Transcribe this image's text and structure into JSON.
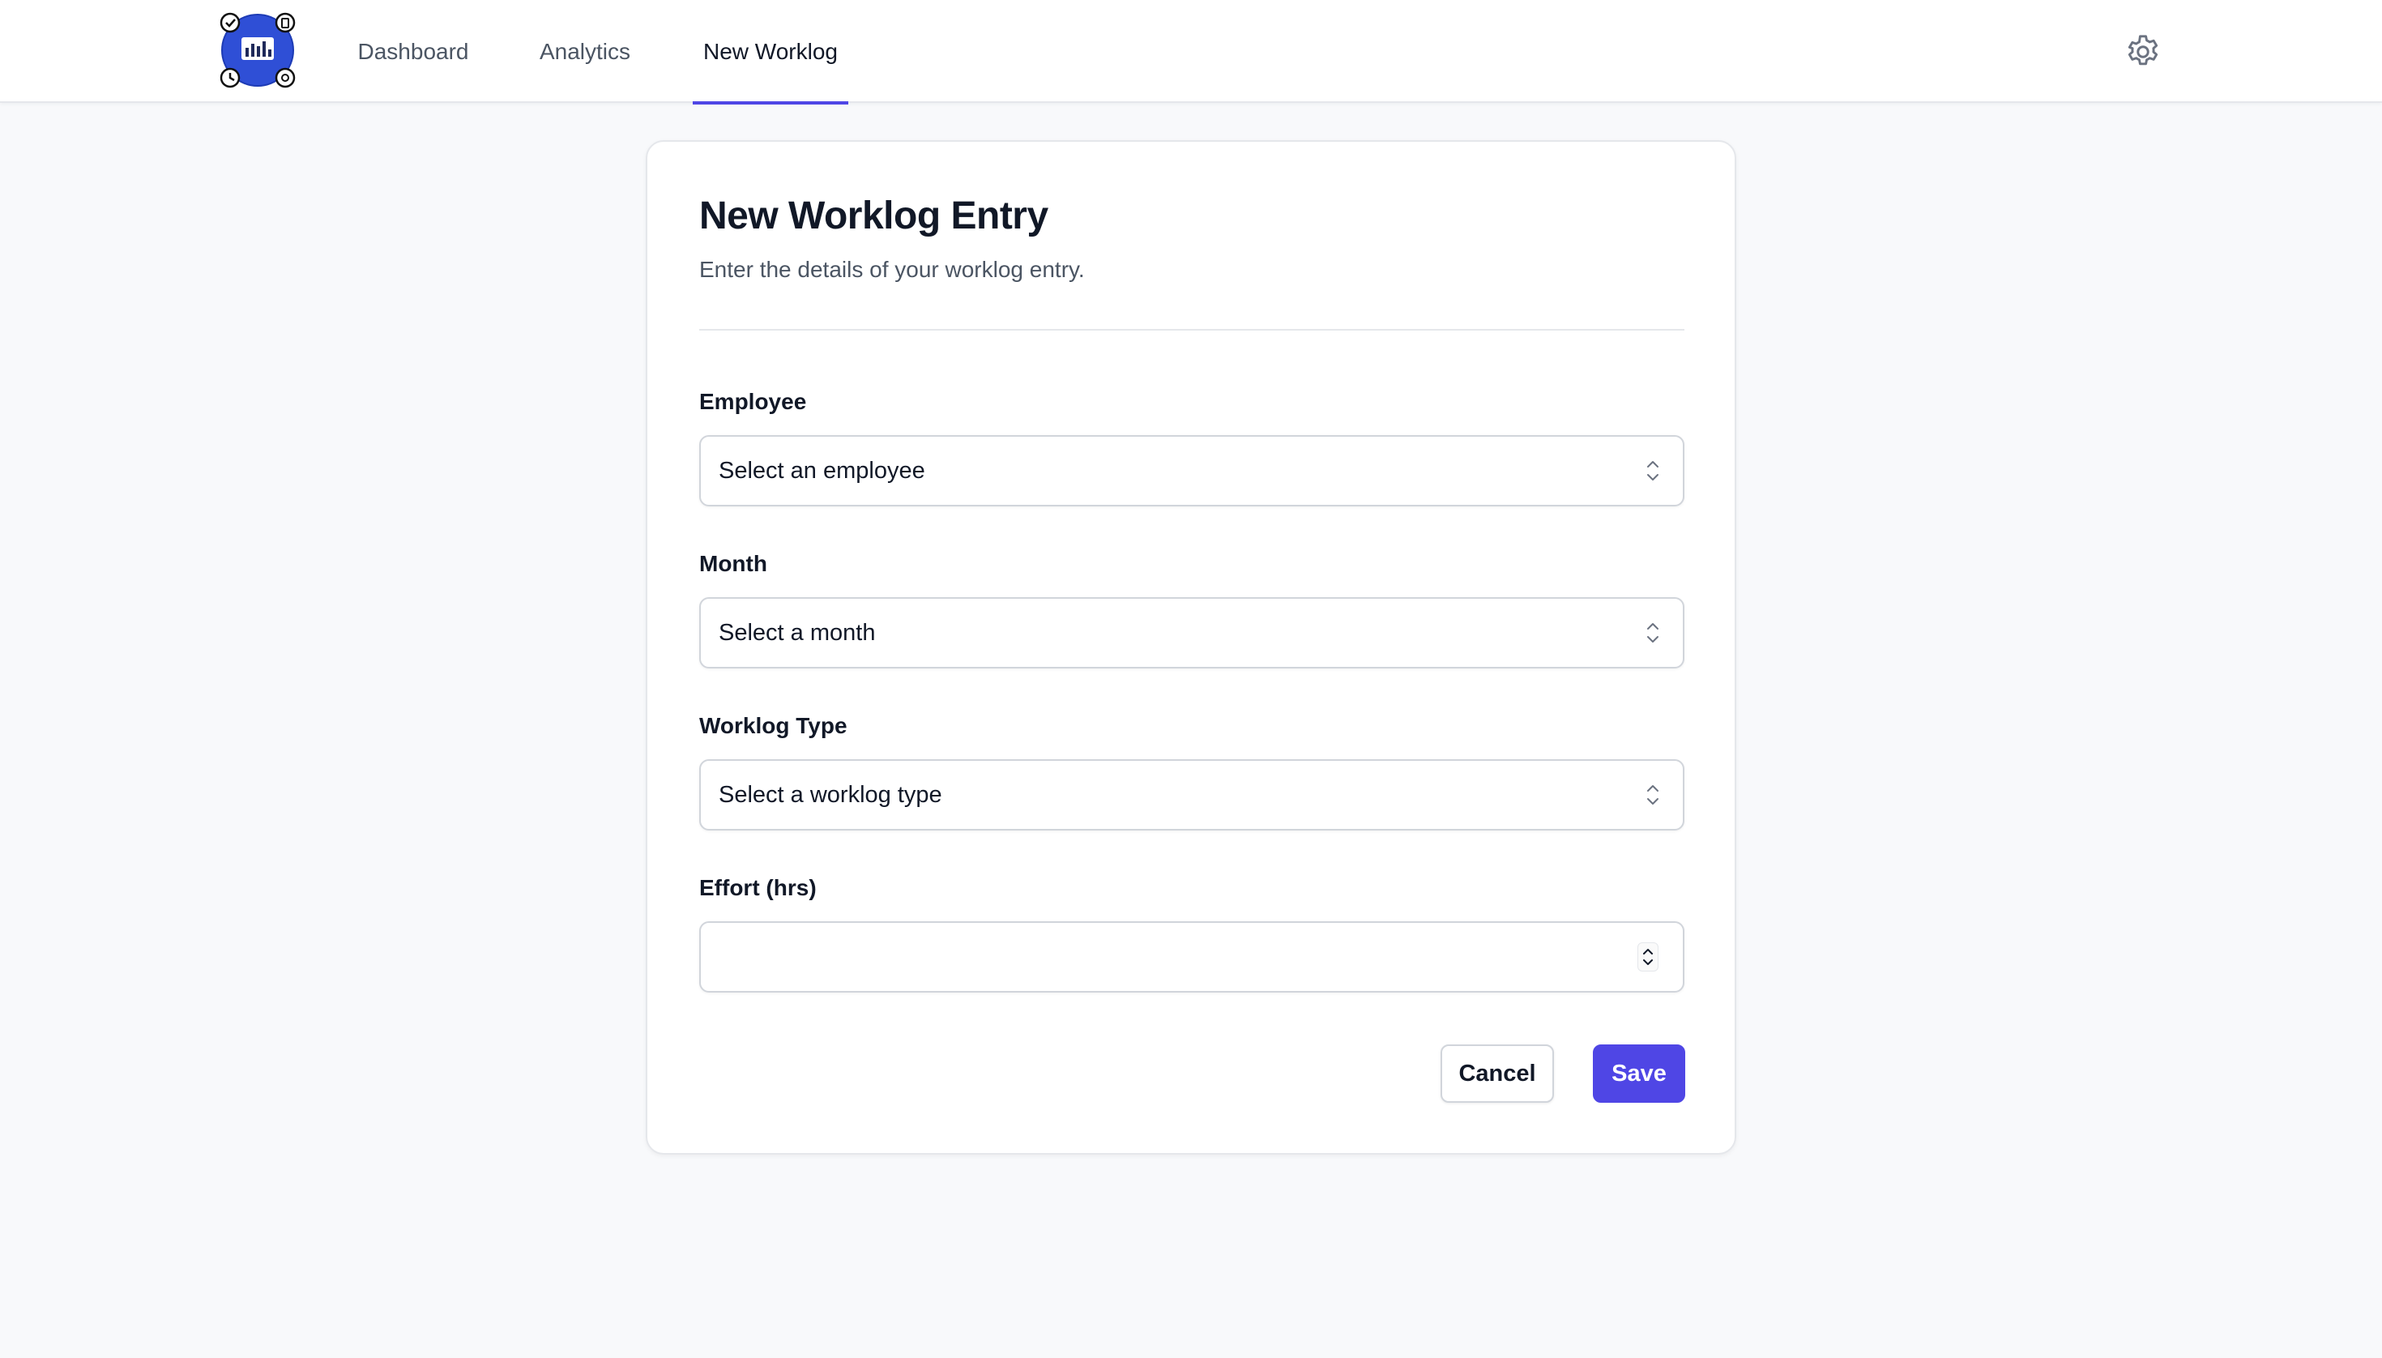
{
  "nav": {
    "tabs": [
      {
        "label": "Dashboard",
        "active": false
      },
      {
        "label": "Analytics",
        "active": false
      },
      {
        "label": "New Worklog",
        "active": true
      }
    ],
    "logo_icon": "worklog-app-logo-icon",
    "settings_icon": "gear-icon",
    "accent_color": "#4f46e5"
  },
  "form": {
    "title": "New Worklog Entry",
    "subtitle": "Enter the details of your worklog entry.",
    "fields": [
      {
        "label": "Employee",
        "value": "Select an employee",
        "type": "select"
      },
      {
        "label": "Month",
        "value": "Select a month",
        "type": "select"
      },
      {
        "label": "Worklog Type",
        "value": "Select a worklog type",
        "type": "select"
      },
      {
        "label": "Effort (hrs)",
        "value": "",
        "type": "number"
      }
    ],
    "cancel_label": "Cancel",
    "save_label": "Save"
  }
}
